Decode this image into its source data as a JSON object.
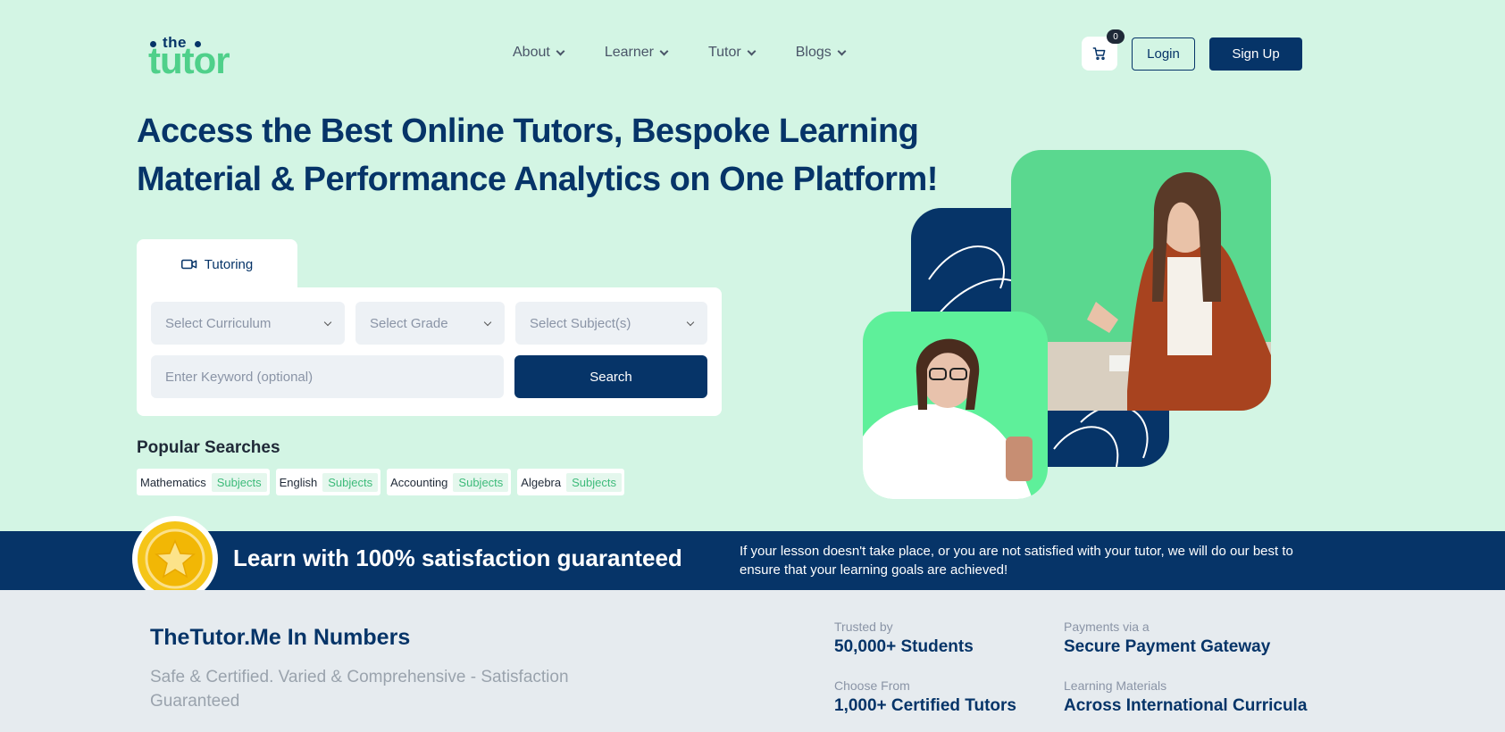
{
  "header": {
    "logo_the": "the",
    "logo_tutor": "tutor",
    "nav": [
      {
        "label": "About"
      },
      {
        "label": "Learner"
      },
      {
        "label": "Tutor"
      },
      {
        "label": "Blogs"
      }
    ],
    "cart_count": "0",
    "login_label": "Login",
    "signup_label": "Sign Up"
  },
  "hero": {
    "title": "Access the Best Online Tutors, Bespoke Learning Material & Performance Analytics on One Platform!",
    "tab_label": "Tutoring",
    "selects": {
      "curriculum": "Select Curriculum",
      "grade": "Select Grade",
      "subjects": "Select Subject(s)"
    },
    "keyword_placeholder": "Enter Keyword (optional)",
    "search_label": "Search",
    "popular_title": "Popular Searches",
    "popular": [
      {
        "name": "Mathematics",
        "tag": "Subjects"
      },
      {
        "name": "English",
        "tag": "Subjects"
      },
      {
        "name": "Accounting",
        "tag": "Subjects"
      },
      {
        "name": "Algebra",
        "tag": "Subjects"
      }
    ]
  },
  "guarantee": {
    "title": "Learn with 100% satisfaction guaranteed",
    "text": "If your lesson doesn't take place, or you are not satisfied with your tutor, we will do our best to ensure that your learning goals are achieved!"
  },
  "numbers": {
    "title": "TheTutor.Me In Numbers",
    "subtitle": "Safe & Certified. Varied & Comprehensive - Satisfaction Guaranteed",
    "stats": [
      {
        "label": "Trusted by",
        "value": "50,000+ Students"
      },
      {
        "label": "Payments via a",
        "value": "Secure Payment Gateway"
      },
      {
        "label": "Choose From",
        "value": "1,000+ Certified Tutors"
      },
      {
        "label": "Learning Materials",
        "value": "Across International Curricula"
      }
    ]
  },
  "colors": {
    "background": "#d3f5e4",
    "navy": "#063468",
    "green": "#4fd08a"
  }
}
